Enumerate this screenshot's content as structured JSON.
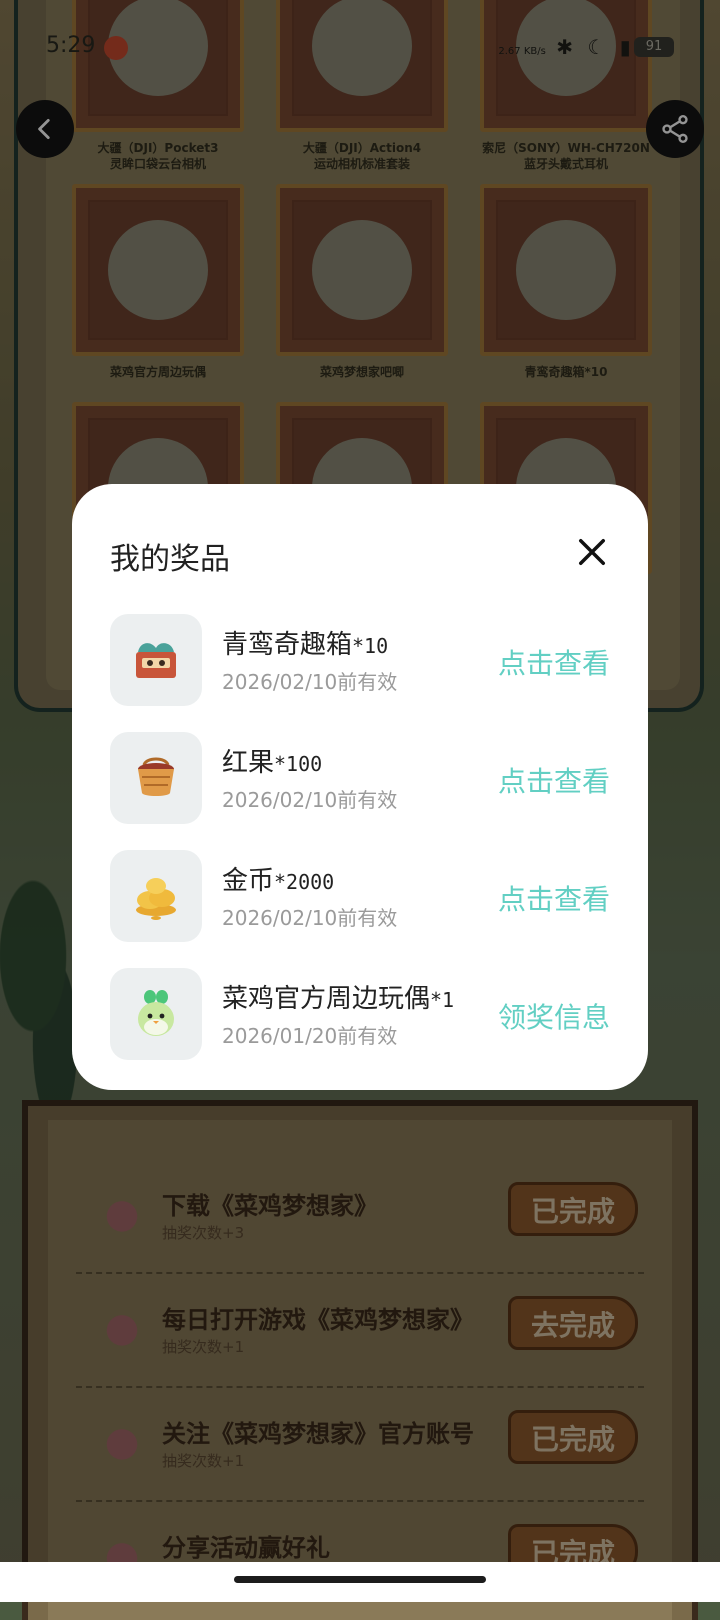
{
  "status_bar": {
    "time": "5:29",
    "net_speed": "2.67 KB/s",
    "battery": "91"
  },
  "prizes": [
    {
      "caption_line1": "大疆（DJI）Pocket3",
      "caption_line2": "灵眸口袋云台相机"
    },
    {
      "caption_line1": "大疆（DJI）Action4",
      "caption_line2": "运动相机标准套装"
    },
    {
      "caption_line1": "索尼（SONY）WH-CH720N",
      "caption_line2": "蓝牙头戴式耳机"
    },
    {
      "caption_line1": "菜鸡官方周边玩偶",
      "caption_line2": ""
    },
    {
      "caption_line1": "菜鸡梦想家吧唧",
      "caption_line2": ""
    },
    {
      "caption_line1": "青鸾奇趣箱*10",
      "caption_line2": ""
    }
  ],
  "modal": {
    "title": "我的奖品",
    "items": [
      {
        "name": "青鸾奇趣箱",
        "qty": "*10",
        "expiry": "2026/02/10前有效",
        "action": "点击查看",
        "icon": "gift-box-icon"
      },
      {
        "name": "红果",
        "qty": "*100",
        "expiry": "2026/02/10前有效",
        "action": "点击查看",
        "icon": "fruit-basket-icon"
      },
      {
        "name": "金币",
        "qty": "*2000",
        "expiry": "2026/02/10前有效",
        "action": "点击查看",
        "icon": "gold-coins-icon"
      },
      {
        "name": "菜鸡官方周边玩偶",
        "qty": "*1",
        "expiry": "2026/01/20前有效",
        "action": "领奖信息",
        "icon": "chick-plush-icon"
      }
    ]
  },
  "tasks": [
    {
      "title": "下载《菜鸡梦想家》",
      "sub": "抽奖次数+3",
      "button": "已完成"
    },
    {
      "title": "每日打开游戏《菜鸡梦想家》",
      "sub": "抽奖次数+1",
      "button": "去完成"
    },
    {
      "title": "关注《菜鸡梦想家》官方账号",
      "sub": "抽奖次数+1",
      "button": "已完成"
    },
    {
      "title": "分享活动赢好礼",
      "sub": "",
      "button": "已完成"
    }
  ],
  "colors": {
    "accent_teal": "#62cfc3",
    "modal_bg": "#ffffff",
    "thumb_bg": "#eceff0"
  }
}
